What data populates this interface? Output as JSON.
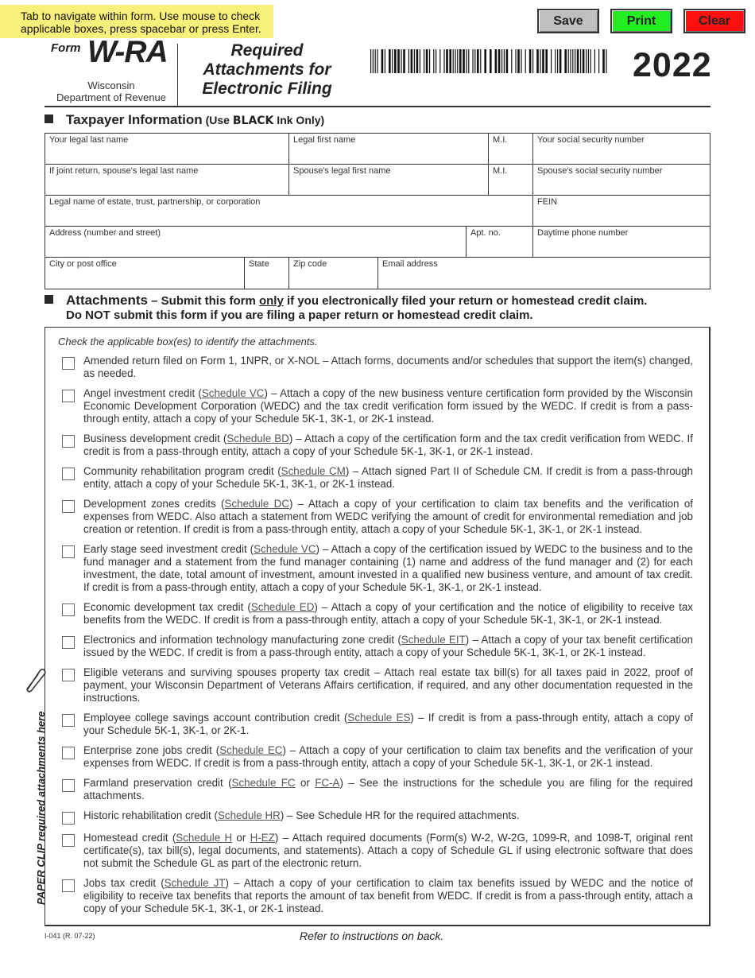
{
  "hint": "Tab to navigate within form. Use mouse to check applicable boxes, press spacebar or press Enter.",
  "toolbar": {
    "save_label": "Save",
    "print_label": "Print",
    "clear_label": "Clear",
    "colors": {
      "save": "#bfbfbf",
      "print": "#22ee22",
      "clear": "#ff1010"
    }
  },
  "header": {
    "form_label": "Form",
    "form_id": "W-RA",
    "agency_line1": "Wisconsin",
    "agency_line2": "Department of Revenue",
    "title_line1": "Required",
    "title_line2": "Attachments for",
    "title_line3": "Electronic Filing",
    "year": "2022"
  },
  "taxpayer": {
    "heading": "Taxpayer Information",
    "subheading_pre": "(Use ",
    "subheading_bold": "BLACK",
    "subheading_post": " Ink Only)",
    "fields": {
      "last_name": "Your legal last name",
      "first_name": "Legal first name",
      "mi": "M.I.",
      "ssn": "Your social security number",
      "spouse_last": "If joint return, spouse's legal last name",
      "spouse_first": "Spouse's legal first name",
      "spouse_mi": "M.I.",
      "spouse_ssn": "Spouse's social security number",
      "entity_name": "Legal name of estate, trust, partnership, or corporation",
      "fein": "FEIN",
      "address": "Address (number and street)",
      "apt": "Apt. no.",
      "phone": "Daytime phone number",
      "city": "City or post office",
      "state": "State",
      "zip": "Zip code",
      "email": "Email address"
    }
  },
  "attachments": {
    "heading": "Attachments",
    "line1_pre": " – Submit this form ",
    "line1_u": "only",
    "line1_post": " if you electronically filed your return or homestead credit claim.",
    "line2": "Do NOT submit this form if you are filing a paper return or homestead credit claim.",
    "instruction": "Check the applicable box(es) to identify the attachments.",
    "items": [
      {
        "pre": "Amended return filed on Form 1, 1NPR, or X-NOL – Attach forms, documents and/or schedules that support the item(s) changed, as needed.",
        "link1": "",
        "mid": "",
        "link2": "",
        "post": "",
        "checked": false
      },
      {
        "pre": "Angel investment credit (",
        "link1": "Schedule VC",
        "mid": "",
        "link2": "",
        "post": ") – Attach a copy of the new business venture certification form provided by the Wisconsin Economic Development Corporation (WEDC) and the tax credit verification form issued by the WEDC. If credit is from a pass-through entity, attach a copy of your Schedule 5K-1, 3K-1, or 2K-1 instead.",
        "checked": false
      },
      {
        "pre": "Business development credit (",
        "link1": "Schedule BD",
        "mid": "",
        "link2": "",
        "post": ") – Attach a copy of the certification form and the tax credit verification from WEDC. If credit is from a pass-through entity, attach a copy of your Schedule 5K-1, 3K-1, or 2K-1 instead.",
        "checked": false
      },
      {
        "pre": "Community rehabilitation program credit (",
        "link1": "Schedule CM",
        "mid": "",
        "link2": "",
        "post": ") – Attach signed Part II of Schedule CM. If credit is from a pass-through entity, attach a copy of your Schedule 5K-1, 3K-1, or 2K-1 instead.",
        "checked": false
      },
      {
        "pre": "Development zones credits (",
        "link1": "Schedule DC",
        "mid": "",
        "link2": "",
        "post": ") – Attach a copy of your certification to claim tax benefits and the verification of expenses from WEDC. Also attach a statement from WEDC verifying the amount of credit for environmental remediation and job creation or retention. If credit is from a pass-through entity, attach a copy of your Schedule 5K-1, 3K-1, or 2K-1 instead.",
        "checked": false
      },
      {
        "pre": "Early stage seed investment credit (",
        "link1": "Schedule VC",
        "mid": "",
        "link2": "",
        "post": ") – Attach a copy of the certification issued by WEDC to the business and to the fund manager and a statement from the fund manager containing (1) name and address of the fund manager and (2) for each investment, the date, total amount of investment, amount invested in a qualified new business venture, and amount of tax credit. If credit is from a pass-through entity, attach a copy of your Schedule 5K-1, 3K-1, or 2K-1 instead.",
        "checked": false
      },
      {
        "pre": "Economic development tax credit (",
        "link1": "Schedule ED",
        "mid": "",
        "link2": "",
        "post": ") – Attach a copy of your certification and the notice of eligibility to receive tax benefits from the WEDC. If credit is from a pass-through entity, attach a copy of your Schedule 5K-1, 3K-1, or 2K-1 instead.",
        "checked": false
      },
      {
        "pre": "Electronics and information technology manufacturing zone credit (",
        "link1": "Schedule EIT",
        "mid": "",
        "link2": "",
        "post": ") – Attach a copy of your tax benefit certification issued by the WEDC. If credit is from a pass-through entity, attach a copy of your Schedule 5K-1, 3K-1, or 2K-1 instead.",
        "checked": false
      },
      {
        "pre": "Eligible veterans and surviving spouses property tax credit – Attach real estate tax bill(s) for all taxes paid in 2022, proof of payment, your Wisconsin Department of Veterans Affairs certification, if required, and any other documentation requested in the instructions.",
        "link1": "",
        "mid": "",
        "link2": "",
        "post": "",
        "checked": false
      },
      {
        "pre": "Employee college savings account contribution credit (",
        "link1": "Schedule ES",
        "mid": "",
        "link2": "",
        "post": ") – If credit is from a pass-through entity, attach a copy of your Schedule 5K-1, 3K-1, or 2K-1.",
        "checked": false
      },
      {
        "pre": "Enterprise zone jobs credit (",
        "link1": "Schedule EC",
        "mid": "",
        "link2": "",
        "post": ") – Attach a copy of your certification to claim tax benefits and the verification of your expenses from WEDC. If credit is from a pass-through entity, attach a copy of your Schedule 5K-1, 3K-1, or 2K-1 instead.",
        "checked": false
      },
      {
        "pre": "Farmland preservation credit (",
        "link1": "Schedule FC",
        "mid": " or ",
        "link2": "FC-A",
        "post": ") – See the instructions for the schedule you are filing for the required attachments.",
        "checked": false
      },
      {
        "pre": "Historic rehabilitation credit (",
        "link1": "Schedule HR",
        "mid": "",
        "link2": "",
        "post": ") – See Schedule HR for the required attachments.",
        "checked": false
      },
      {
        "pre": "Homestead credit (",
        "link1": "Schedule H",
        "mid": " or ",
        "link2": "H-EZ",
        "post": ") – Attach required documents (Form(s) W-2, W-2G, 1099-R, and 1098-T, original rent certificate(s), tax bill(s), legal documents, and statements). Attach a copy of Schedule GL if using electronic software that does not submit the Schedule GL as part of the electronic return.",
        "checked": false
      },
      {
        "pre": "Jobs tax credit (",
        "link1": "Schedule JT",
        "mid": "",
        "link2": "",
        "post": ") – Attach a copy of your certification to claim tax benefits issued by WEDC and the notice of eligibility to receive tax benefits that reports the amount of tax benefit from WEDC. If credit is from a pass-through entity, attach a copy of your Schedule 5K-1, 3K-1, or 2K-1 instead.",
        "checked": false
      }
    ]
  },
  "side_note": "PAPER CLIP required attachments here",
  "footer": {
    "form_number": "I-041 (R. 07-22)",
    "refer": "Refer to instructions on back."
  }
}
